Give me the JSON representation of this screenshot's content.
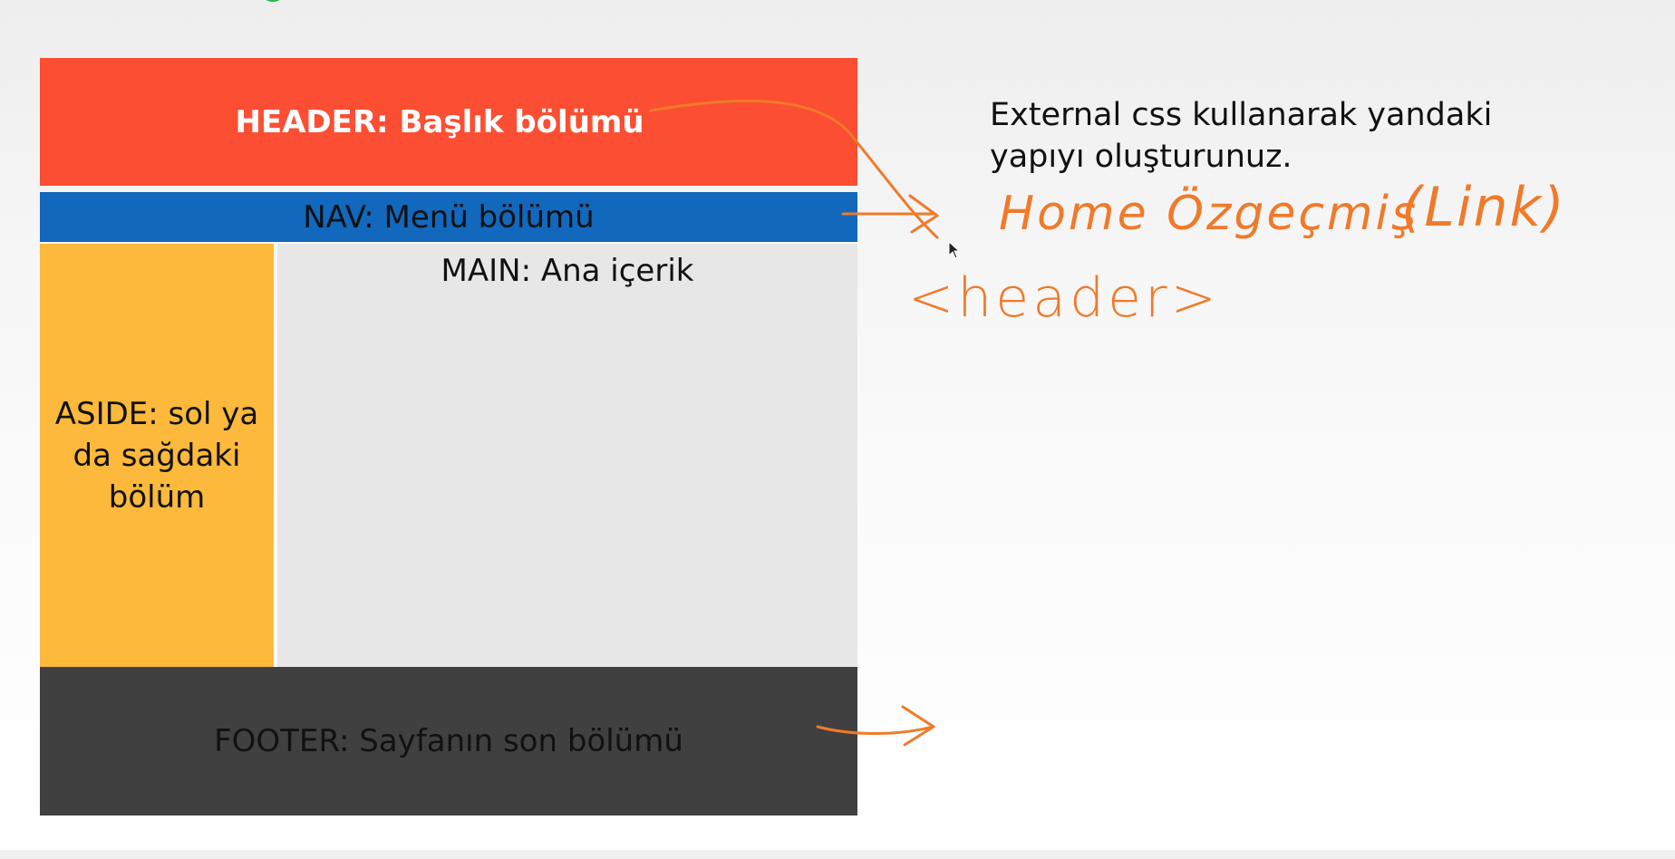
{
  "layout_sections": {
    "header": "HEADER: Başlık bölümü",
    "nav": "NAV: Menü bölümü",
    "main": "MAIN: Ana içerik",
    "aside": "ASIDE: sol ya da sağdaki bölüm",
    "footer": "FOOTER: Sayfanın son bölümü"
  },
  "instruction": "External css kullanarak yandaki yapıyı oluşturunuz.",
  "handwritten_notes": {
    "menu_items": "Home Özgeçmiş",
    "link_note": "(Link)",
    "header_tag": "<header>"
  },
  "colors": {
    "header": "#fc4e32",
    "nav": "#1168bd",
    "aside": "#fdb93b",
    "main": "#e7e7e7",
    "footer": "#404040",
    "annotation": "#f07a2a"
  }
}
